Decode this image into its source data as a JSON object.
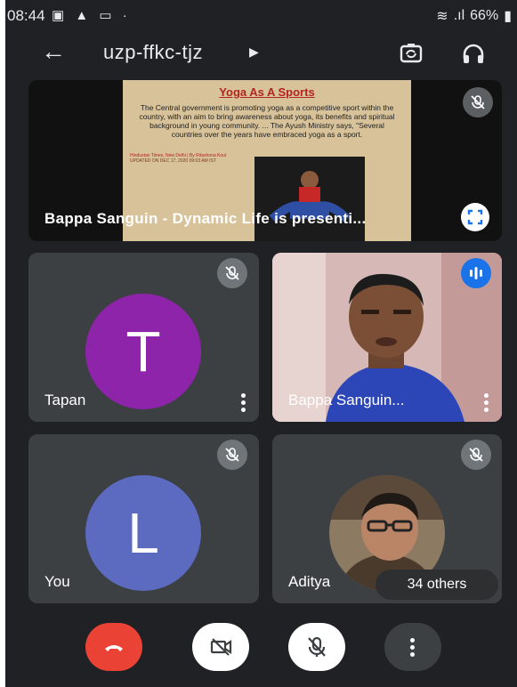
{
  "status": {
    "time": "08:44",
    "battery": "66%"
  },
  "topbar": {
    "meeting_code": "uzp-ffkc-tjz"
  },
  "presentation": {
    "presenter_label": "Bappa Sanguin - Dynamic Life is presenti...",
    "slide_title": "Yoga As A Sports",
    "slide_text": "The Central government is promoting yoga as a competitive sport within the country, with an aim to bring awareness about yoga, its benefits and spiritual background in young community. ... The Ayush Ministry says, \"Several countries over the years have embraced yoga as a sport.",
    "slide_credit_line1": "Hindustan Times, New Delhi | By Ritashona Koul",
    "slide_credit_line2": "UPDATED ON DEC 17, 2020 09:03 AM IST"
  },
  "participants": {
    "tapan": {
      "name": "Tapan",
      "initial": "T",
      "avatar_color": "#8e24aa"
    },
    "bappa": {
      "name": "Bappa Sanguin..."
    },
    "you": {
      "name": "You",
      "initial": "L",
      "avatar_color": "#5c6bc0"
    },
    "aditya": {
      "name": "Aditya",
      "others_label": "34 others"
    }
  },
  "colors": {
    "end_call": "#ea4335",
    "speaking": "#1a73e8",
    "background": "#202124",
    "tile": "#3c4043"
  }
}
